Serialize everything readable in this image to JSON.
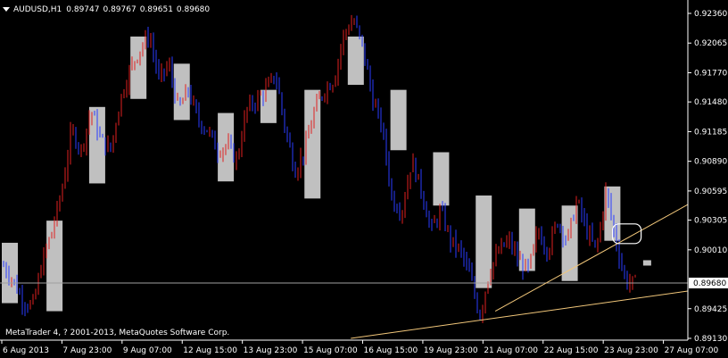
{
  "header": {
    "symbol_timeframe": "AUDUSD,H1",
    "open": "0.89747",
    "high": "0.89767",
    "low": "0.89651",
    "close": "0.89680"
  },
  "copyright": "MetaTrader 4, ? 2001-2013, MetaQuotes Software Corp.",
  "colors": {
    "background": "#000000",
    "bull_candle": "#e02020",
    "bear_candle": "#2a3cff",
    "highlight_box": "#c0c0c0",
    "trendline": "#f2c77a",
    "bid_line": "#a0a0a0",
    "axis_text": "#ffffff"
  },
  "price_axis": {
    "min": 0.8913,
    "max": 0.9236,
    "ticks": [
      "0.92360",
      "0.92065",
      "0.91770",
      "0.91480",
      "0.91185",
      "0.90890",
      "0.90595",
      "0.90305",
      "0.90010",
      "0.89425",
      "0.89130"
    ],
    "current_price_label": "0.89680",
    "current_price": 0.8968
  },
  "time_axis": {
    "labels": [
      "6 Aug 2013",
      "7 Aug 23:00",
      "9 Aug 07:00",
      "12 Aug 15:00",
      "13 Aug 23:00",
      "15 Aug 07:00",
      "16 Aug 15:00",
      "19 Aug 23:00",
      "21 Aug 07:00",
      "22 Aug 15:00",
      "23 Aug 23:00",
      "27 Aug 07:00"
    ]
  },
  "chart_data": {
    "type": "candlestick",
    "title": "",
    "price_path": [
      0.8985,
      0.897,
      0.895,
      0.8945,
      0.899,
      0.902,
      0.906,
      0.912,
      0.91,
      0.914,
      0.911,
      0.91,
      0.915,
      0.918,
      0.92,
      0.9215,
      0.917,
      0.9185,
      0.914,
      0.916,
      0.913,
      0.912,
      0.91,
      0.9105,
      0.909,
      0.914,
      0.915,
      0.916,
      0.9175,
      0.912,
      0.908,
      0.91,
      0.914,
      0.916,
      0.917,
      0.9215,
      0.923,
      0.92,
      0.915,
      0.912,
      0.905,
      0.904,
      0.909,
      0.906,
      0.902,
      0.904,
      0.901,
      0.9,
      0.8975,
      0.8935,
      0.898,
      0.9,
      0.901,
      0.899,
      0.898,
      0.902,
      0.9,
      0.903,
      0.901,
      0.905,
      0.902,
      0.9,
      0.906,
      0.901,
      0.897,
      0.8968
    ],
    "highlight_boxes": [
      {
        "x_frac": 0.0,
        "high": 0.9008,
        "low": 0.8948
      },
      {
        "x_frac": 0.065,
        "high": 0.903,
        "low": 0.894
      },
      {
        "x_frac": 0.127,
        "high": 0.9143,
        "low": 0.9067
      },
      {
        "x_frac": 0.187,
        "high": 0.9213,
        "low": 0.9151
      },
      {
        "x_frac": 0.25,
        "high": 0.9186,
        "low": 0.913
      },
      {
        "x_frac": 0.314,
        "high": 0.9137,
        "low": 0.9069
      },
      {
        "x_frac": 0.376,
        "high": 0.916,
        "low": 0.9127
      },
      {
        "x_frac": 0.44,
        "high": 0.916,
        "low": 0.9052
      },
      {
        "x_frac": 0.503,
        "high": 0.9213,
        "low": 0.9165
      },
      {
        "x_frac": 0.565,
        "high": 0.916,
        "low": 0.91
      },
      {
        "x_frac": 0.627,
        "high": 0.9098,
        "low": 0.9045
      },
      {
        "x_frac": 0.689,
        "high": 0.9055,
        "low": 0.8963
      },
      {
        "x_frac": 0.752,
        "high": 0.9042,
        "low": 0.898
      },
      {
        "x_frac": 0.814,
        "high": 0.9045,
        "low": 0.897
      },
      {
        "x_frac": 0.876,
        "high": 0.9064,
        "low": 0.901
      }
    ],
    "trendlines": [
      {
        "x1_frac": 0.72,
        "y1": 0.894,
        "x2_frac": 1.0,
        "y2": 0.9046
      },
      {
        "x1_frac": 0.51,
        "y1": 0.8913,
        "x2_frac": 1.0,
        "y2": 0.896
      }
    ],
    "marker_ellipse": {
      "x_frac": 0.91,
      "price": 0.9017
    },
    "current_marker": {
      "x_frac": 0.935,
      "price": 0.8988
    }
  }
}
